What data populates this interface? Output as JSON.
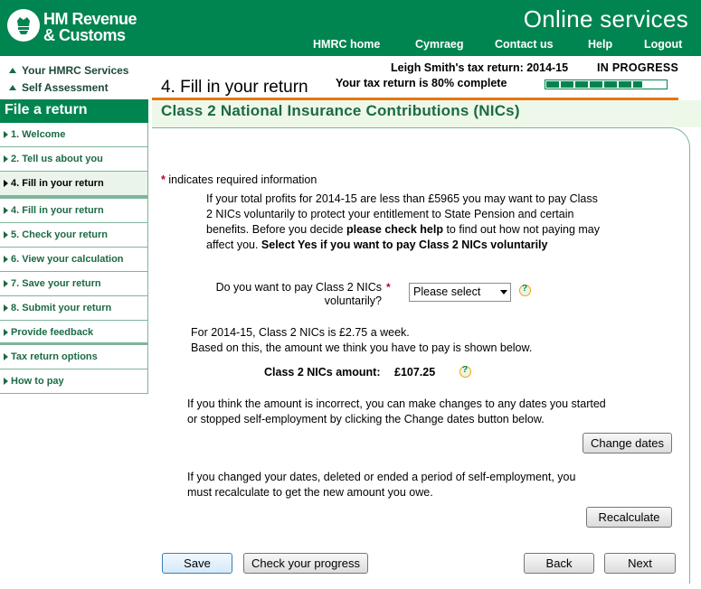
{
  "header": {
    "logo_line1": "HM Revenue",
    "logo_line2": "& Customs",
    "service_name": "Online services",
    "nav": [
      {
        "label": "HMRC home"
      },
      {
        "label": "Cymraeg"
      },
      {
        "label": "Contact us"
      },
      {
        "label": "Help"
      },
      {
        "label": "Logout"
      }
    ]
  },
  "breadcrumbs": [
    {
      "label": "Your HMRC Services"
    },
    {
      "label": "Self Assessment"
    }
  ],
  "sidebar": {
    "heading": "File a return",
    "items": [
      {
        "label": "1. Welcome"
      },
      {
        "label": "2. Tell us about you"
      },
      {
        "label": "4. Fill in your return"
      },
      {
        "label": "4. Fill in your return"
      },
      {
        "label": "5. Check your return"
      },
      {
        "label": "6. View your calculation"
      },
      {
        "label": "7. Save your return"
      },
      {
        "label": "8. Submit your return"
      },
      {
        "label": "Provide feedback"
      },
      {
        "label": "Tax return options"
      },
      {
        "label": "How to pay"
      }
    ],
    "active_index": 2
  },
  "status": {
    "return_title": "Leigh Smith's tax return: 2014-15",
    "state": "IN PROGRESS",
    "complete_text": "Your tax return is 80% complete",
    "progress_fraction": 0.8
  },
  "page": {
    "title": "4. Fill in your return",
    "section_title": "Class 2 National Insurance Contributions (NICs)"
  },
  "form": {
    "required_note": "indicates required information",
    "required_marker": "*",
    "intro_1": "If your total profits for 2014-15 are less than £5965 you may want to pay Class 2 NICs voluntarily to protect your entitlement to State Pension and certain benefits.  Before you decide ",
    "intro_bold_1": "please check help",
    "intro_2": " to find out how not paying may affect you. ",
    "intro_bold_2": "Select Yes if you want to pay Class 2 NICs voluntarily",
    "question": "Do you want to pay Class 2 NICs voluntarily?",
    "select_value": "Please select",
    "rate_line1": "For 2014-15, Class 2 NICs is £2.75 a week.",
    "rate_line2": "Based on this, the amount we think you have to pay is shown below.",
    "amount_label": "Class 2 NICs amount:",
    "amount_value": "£107.25",
    "dates_note": "If you think the amount is incorrect, you can make changes to any dates you started or stopped self-employment by clicking the Change dates button below.",
    "change_dates_label": "Change dates",
    "recalc_note": "If you changed your dates, deleted or ended a period of self-employment, you must recalculate to get the new amount you owe.",
    "recalculate_label": "Recalculate"
  },
  "footer_buttons": {
    "save": "Save",
    "check_progress": "Check your progress",
    "back": "Back",
    "next": "Next"
  },
  "colors": {
    "brand_green": "#008550",
    "accent_orange": "#e8740c",
    "required_red": "#c0002b"
  },
  "icons": {
    "logo": "crown-crest-icon",
    "breadcrumb": "triangle-up-icon",
    "nav_arrow": "triangle-right-icon",
    "help": "help-icon"
  }
}
